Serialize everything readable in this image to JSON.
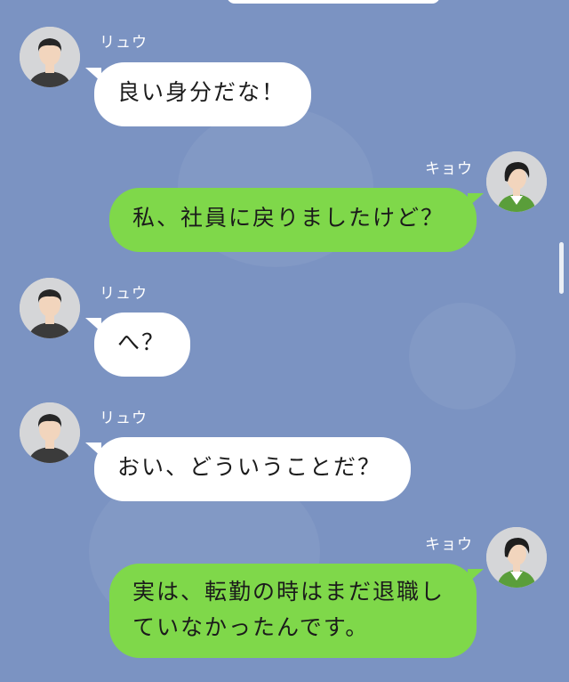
{
  "colors": {
    "background": "#7b93c2",
    "incoming_bubble": "#ffffff",
    "outgoing_bubble": "#7fd84a"
  },
  "participants": {
    "ryu": {
      "name": "リュウ",
      "avatar_icon": "man-avatar-icon"
    },
    "kyo": {
      "name": "キョウ",
      "avatar_icon": "woman-avatar-icon"
    }
  },
  "messages": [
    {
      "sender": "リュウ",
      "direction": "incoming",
      "text": "良い身分だな！"
    },
    {
      "sender": "キョウ",
      "direction": "outgoing",
      "text": "私、社員に戻りましたけど？"
    },
    {
      "sender": "リュウ",
      "direction": "incoming",
      "text": "へ？"
    },
    {
      "sender": "リュウ",
      "direction": "incoming",
      "text": "おい、どういうことだ？"
    },
    {
      "sender": "キョウ",
      "direction": "outgoing",
      "text_lines": [
        "実は、転勤の時はまだ退職し",
        "ていなかったんです。"
      ]
    }
  ]
}
